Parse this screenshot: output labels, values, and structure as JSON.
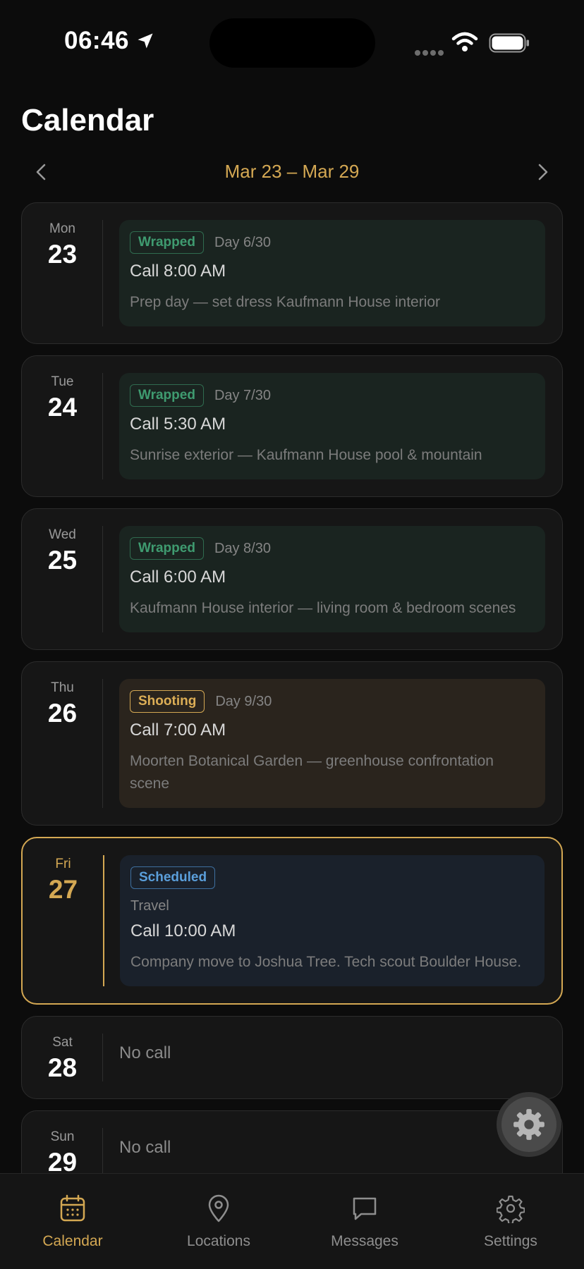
{
  "status": {
    "time": "06:46"
  },
  "page": {
    "title": "Calendar"
  },
  "week": {
    "label": "Mar 23 – Mar 29"
  },
  "days": [
    {
      "dow": "Mon",
      "date": "23",
      "status": "Wrapped",
      "day_count": "Day 6/30",
      "call": "Call 8:00 AM",
      "desc": "Prep day — set dress Kaufmann House interior"
    },
    {
      "dow": "Tue",
      "date": "24",
      "status": "Wrapped",
      "day_count": "Day 7/30",
      "call": "Call 5:30 AM",
      "desc": "Sunrise exterior — Kaufmann House pool & mountain"
    },
    {
      "dow": "Wed",
      "date": "25",
      "status": "Wrapped",
      "day_count": "Day 8/30",
      "call": "Call 6:00 AM",
      "desc": "Kaufmann House interior — living room & bedroom scenes"
    },
    {
      "dow": "Thu",
      "date": "26",
      "status": "Shooting",
      "day_count": "Day 9/30",
      "call": "Call 7:00 AM",
      "desc": "Moorten Botanical Garden — greenhouse confrontation scene"
    },
    {
      "dow": "Fri",
      "date": "27",
      "status": "Scheduled",
      "type": "Travel",
      "call": "Call 10:00 AM",
      "desc": "Company move to Joshua Tree. Tech scout Boulder House."
    },
    {
      "dow": "Sat",
      "date": "28",
      "no_call": "No call"
    },
    {
      "dow": "Sun",
      "date": "29",
      "no_call": "No call"
    }
  ],
  "tabs": [
    {
      "label": "Calendar",
      "icon": "calendar-icon",
      "active": true
    },
    {
      "label": "Locations",
      "icon": "map-pin-icon"
    },
    {
      "label": "Messages",
      "icon": "chat-icon"
    },
    {
      "label": "Settings",
      "icon": "gear-icon"
    }
  ],
  "colors": {
    "accent": "#d4a853",
    "wrapped": "#3f9b70",
    "shooting": "#dcae56",
    "scheduled": "#5b9fdb",
    "background": "#0c0c0c",
    "card": "#161616"
  }
}
